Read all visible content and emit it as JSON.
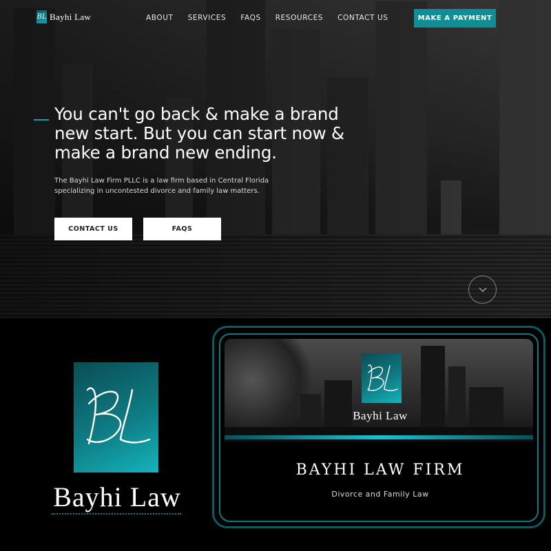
{
  "nav": {
    "logo_mark": "BL",
    "logo_name": "Bayhi Law",
    "items": [
      "ABOUT",
      "SERVICES",
      "FAQS",
      "RESOURCES",
      "CONTACT US"
    ],
    "cta": "MAKE A PAYMENT"
  },
  "hero": {
    "headline": "You can't go back & make a brand new start. But you can start now & make a brand new ending.",
    "subtext": "The Bayhi Law Firm PLLC is a law firm based in Central Florida specializing in uncontested divorce and family law matters.",
    "buttons": [
      "CONTACT US",
      "FAQS"
    ],
    "scroll_icon": "chevron-down-icon"
  },
  "brand_logo": {
    "mark": "BL",
    "name": "Bayhi Law"
  },
  "card": {
    "banner_mark": "BL",
    "banner_name": "Bayhi Law",
    "title": "BAYHI LAW FIRM",
    "subtitle": "Divorce and Family Law"
  },
  "colors": {
    "accent": "#0e8f96",
    "background": "#000000",
    "text": "#ffffff"
  }
}
